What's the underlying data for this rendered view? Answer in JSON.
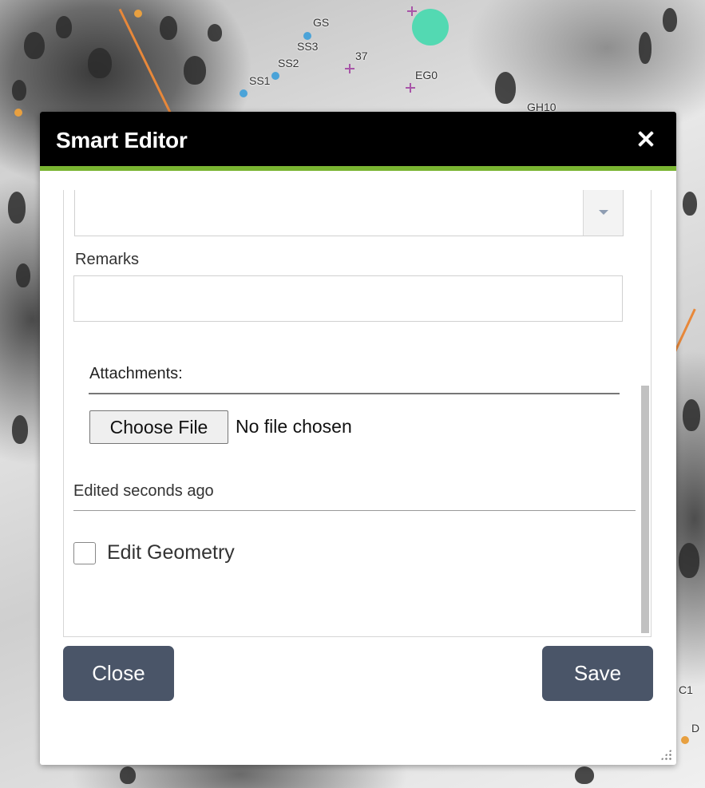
{
  "map": {
    "labels": [
      "GS",
      "SS3",
      "37",
      "SS2",
      "EG0",
      "SS1",
      "GH10",
      "C1",
      "D"
    ]
  },
  "dialog": {
    "title": "Smart Editor",
    "fields": {
      "dropdown_value": "",
      "remarks_label": "Remarks",
      "remarks_value": "",
      "attachments_label": "Attachments:",
      "choose_file_label": "Choose File",
      "no_file_text": "No file chosen",
      "edited_text": "Edited seconds ago",
      "edit_geometry_label": "Edit Geometry",
      "edit_geometry_checked": false
    },
    "buttons": {
      "close_label": "Close",
      "save_label": "Save"
    },
    "colors": {
      "title_bar": "#000000",
      "accent": "#7ab532",
      "button_bg": "#4a5568",
      "selected_point": "#45d9ae"
    }
  }
}
